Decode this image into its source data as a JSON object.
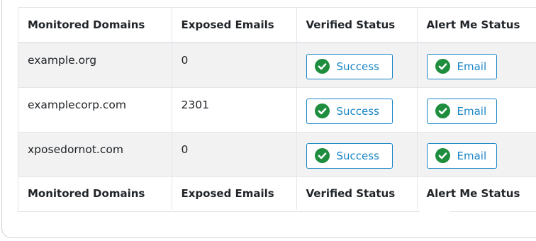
{
  "table": {
    "headers": [
      "Monitored Domains",
      "Exposed Emails",
      "Verified Status",
      "Alert Me Status"
    ],
    "footers": [
      "Monitored Domains",
      "Exposed Emails",
      "Verified Status",
      "Alert Me Status"
    ],
    "rows": [
      {
        "domain": "example.org",
        "exposed": "0",
        "verified": "Success",
        "alert": "Email"
      },
      {
        "domain": "examplecorp.com",
        "exposed": "2301",
        "verified": "Success",
        "alert": "Email"
      },
      {
        "domain": "xposedornot.com",
        "exposed": "0",
        "verified": "Success",
        "alert": "Email"
      }
    ]
  },
  "colors": {
    "accent": "#1a86c6",
    "check_icon": "#1e8e3e",
    "striped_row": "#f2f2f2"
  },
  "icons": {
    "status": "check-circle-icon"
  }
}
